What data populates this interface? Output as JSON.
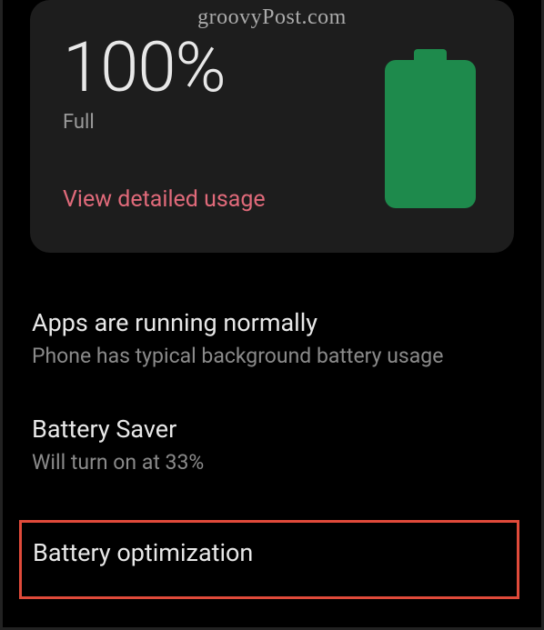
{
  "watermark": "groovyPost.com",
  "battery": {
    "percent": "100%",
    "status": "Full",
    "detailed_link": "View detailed usage",
    "icon_color": "#1e8a4c"
  },
  "settings": {
    "apps": {
      "title": "Apps are running normally",
      "subtitle": "Phone has typical background battery usage"
    },
    "saver": {
      "title": "Battery Saver",
      "subtitle": "Will turn on at 33%"
    },
    "optimization": {
      "title": "Battery optimization"
    }
  }
}
